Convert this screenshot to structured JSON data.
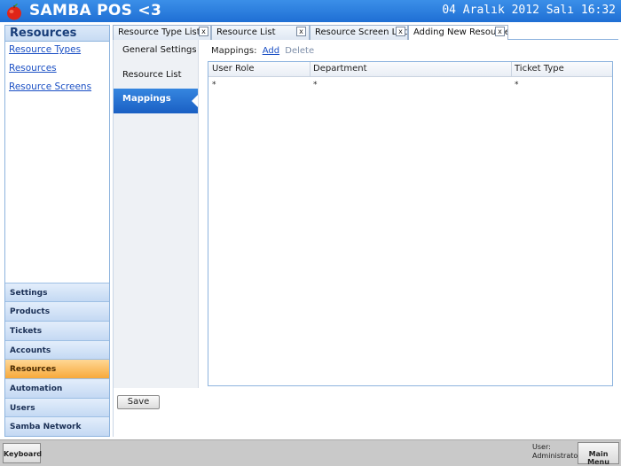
{
  "titlebar": {
    "app_title": "SAMBA POS <3",
    "datetime": "04 Aralık 2012 Salı 16:32"
  },
  "leftnav": {
    "header": "Resources",
    "links": [
      "Resource Types",
      "Resources",
      "Resource Screens"
    ],
    "sections": [
      "Settings",
      "Products",
      "Tickets",
      "Accounts",
      "Resources",
      "Automation",
      "Users",
      "Samba Network"
    ],
    "active_section": "Resources"
  },
  "tabs": [
    {
      "label": "Resource Type List",
      "close": "x"
    },
    {
      "label": "Resource List",
      "close": "x"
    },
    {
      "label": "Resource Screen List",
      "close": "x"
    },
    {
      "label": "Adding New Resource",
      "close": "x"
    }
  ],
  "sidetabs": [
    "General Settings",
    "Resource List",
    "Mappings"
  ],
  "active_sidetab": "Mappings",
  "mappings": {
    "label": "Mappings:",
    "add_label": "Add",
    "delete_label": "Delete"
  },
  "grid": {
    "columns": [
      "User Role",
      "Department",
      "Ticket Type"
    ],
    "rows": [
      [
        "*",
        "*",
        "*"
      ]
    ]
  },
  "save_label": "Save",
  "statusbar": {
    "keyboard_label": "Keyboard",
    "user_label": "User:",
    "user_name": "Administrator",
    "main_menu_label": "Main Menu"
  }
}
